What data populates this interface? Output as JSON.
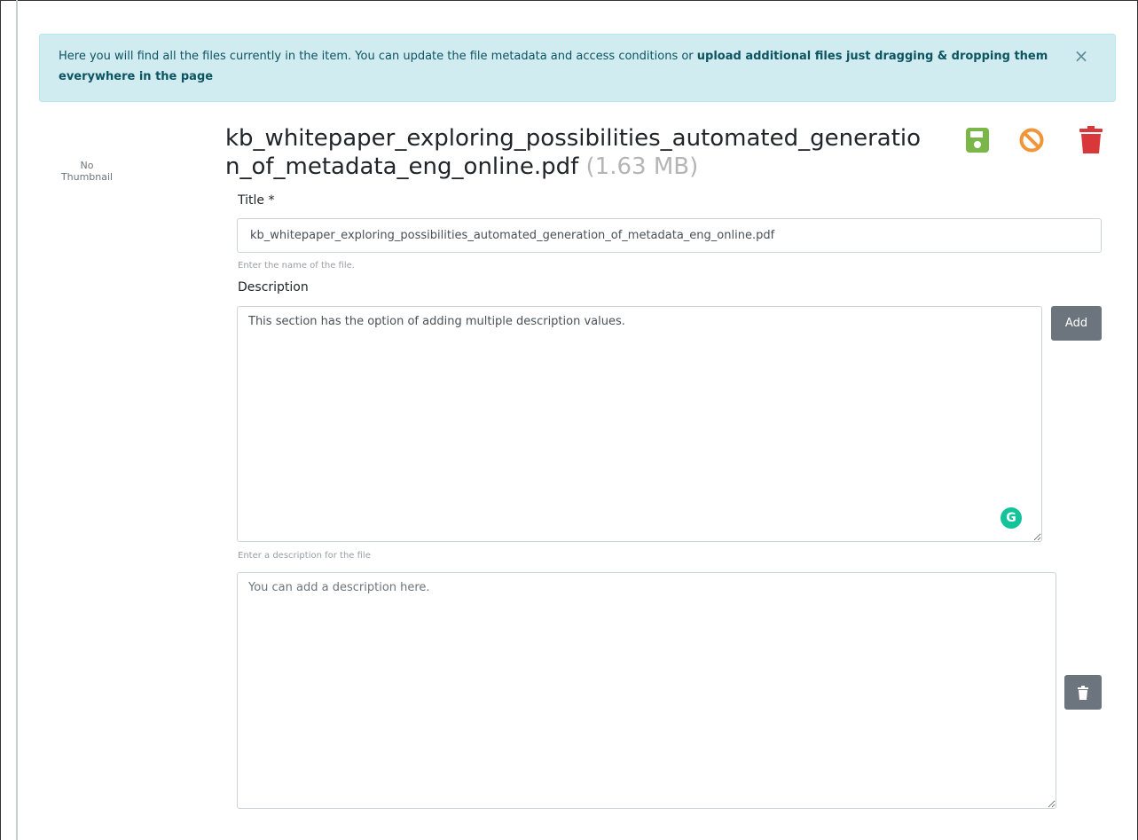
{
  "alert": {
    "text": "Here you will find all the files currently in the item. You can update the file metadata and access conditions or ",
    "bold_text": "upload additional files just dragging & dropping them everywhere in the page",
    "close": "×"
  },
  "thumbnail": {
    "line1": "No",
    "line2": "Thumbnail"
  },
  "file": {
    "name": "kb_whitepaper_exploring_possibilities_automated_generation_of_metadata_eng_online.pdf",
    "size": "(1.63 MB)"
  },
  "actions": {
    "save_icon": "floppy-disk-icon",
    "cancel_icon": "ban-icon",
    "delete_icon": "trash-icon",
    "save_color": "#7ab648",
    "cancel_color": "#f0953a",
    "delete_color": "#d9383a"
  },
  "form": {
    "title_label": "Title *",
    "title_value": "kb_whitepaper_exploring_possibilities_automated_generation_of_metadata_eng_online.pdf",
    "title_help": "Enter the name of the file.",
    "description_label": "Description",
    "description_value": "This section has the option of adding multiple description values.",
    "description_help": "Enter a description for the file",
    "add_label": "Add",
    "second_description_placeholder": "You can add a description here."
  }
}
